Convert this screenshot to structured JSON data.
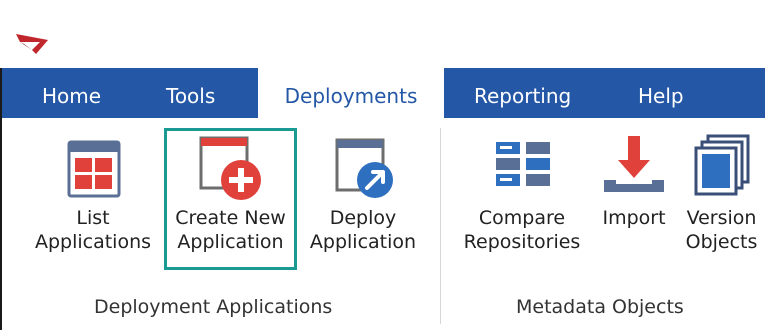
{
  "ribbon": {
    "tabs": [
      {
        "label": "Home"
      },
      {
        "label": "Tools"
      },
      {
        "label": "Deployments",
        "active": true
      },
      {
        "label": "Reporting"
      },
      {
        "label": "Help"
      }
    ],
    "groups": [
      {
        "label": "Deployment Applications",
        "buttons": [
          {
            "line1": "List",
            "line2": "Applications",
            "icon": "list-applications-icon"
          },
          {
            "line1": "Create New",
            "line2": "Application",
            "icon": "create-new-application-icon",
            "highlighted": true
          },
          {
            "line1": "Deploy",
            "line2": "Application",
            "icon": "deploy-application-icon"
          }
        ]
      },
      {
        "label": "Metadata Objects",
        "buttons": [
          {
            "line1": "Compare",
            "line2": "Repositories",
            "icon": "compare-repositories-icon"
          },
          {
            "line1": "Import",
            "line2": "",
            "icon": "import-icon"
          },
          {
            "line1": "Version",
            "line2": "Objects",
            "icon": "version-objects-icon"
          }
        ]
      }
    ]
  },
  "colors": {
    "tab_bar": "#2458a6",
    "highlight_border": "#1a9a93",
    "accent_red": "#e0413a",
    "icon_blue": "#2e6fc0"
  }
}
